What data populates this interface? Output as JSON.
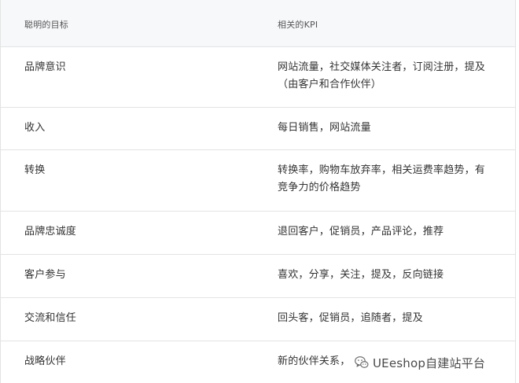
{
  "table": {
    "header": {
      "goal": "聪明的目标",
      "kpi": "相关的KPI"
    },
    "rows": [
      {
        "goal": "品牌意识",
        "kpi": "网站流量，社交媒体关注者，订阅注册，提及（由客户和合作伙伴）"
      },
      {
        "goal": "收入",
        "kpi": "每日销售，网站流量"
      },
      {
        "goal": "转换",
        "kpi": "转换率，购物车放弃率，相关运费率趋势，有竞争力的价格趋势"
      },
      {
        "goal": "品牌忠诚度",
        "kpi": "退回客户，促销员，产品评论，推荐"
      },
      {
        "goal": "客户参与",
        "kpi": "喜欢，分享，关注，提及，反向链接"
      },
      {
        "goal": "交流和信任",
        "kpi": "回头客，促销员，追随者，提及"
      },
      {
        "goal": "战略伙伴",
        "kpi": "新的伙伴关系，"
      }
    ]
  },
  "watermark": {
    "icon": "wechat-icon",
    "text": "UEeshop自建站平台"
  }
}
